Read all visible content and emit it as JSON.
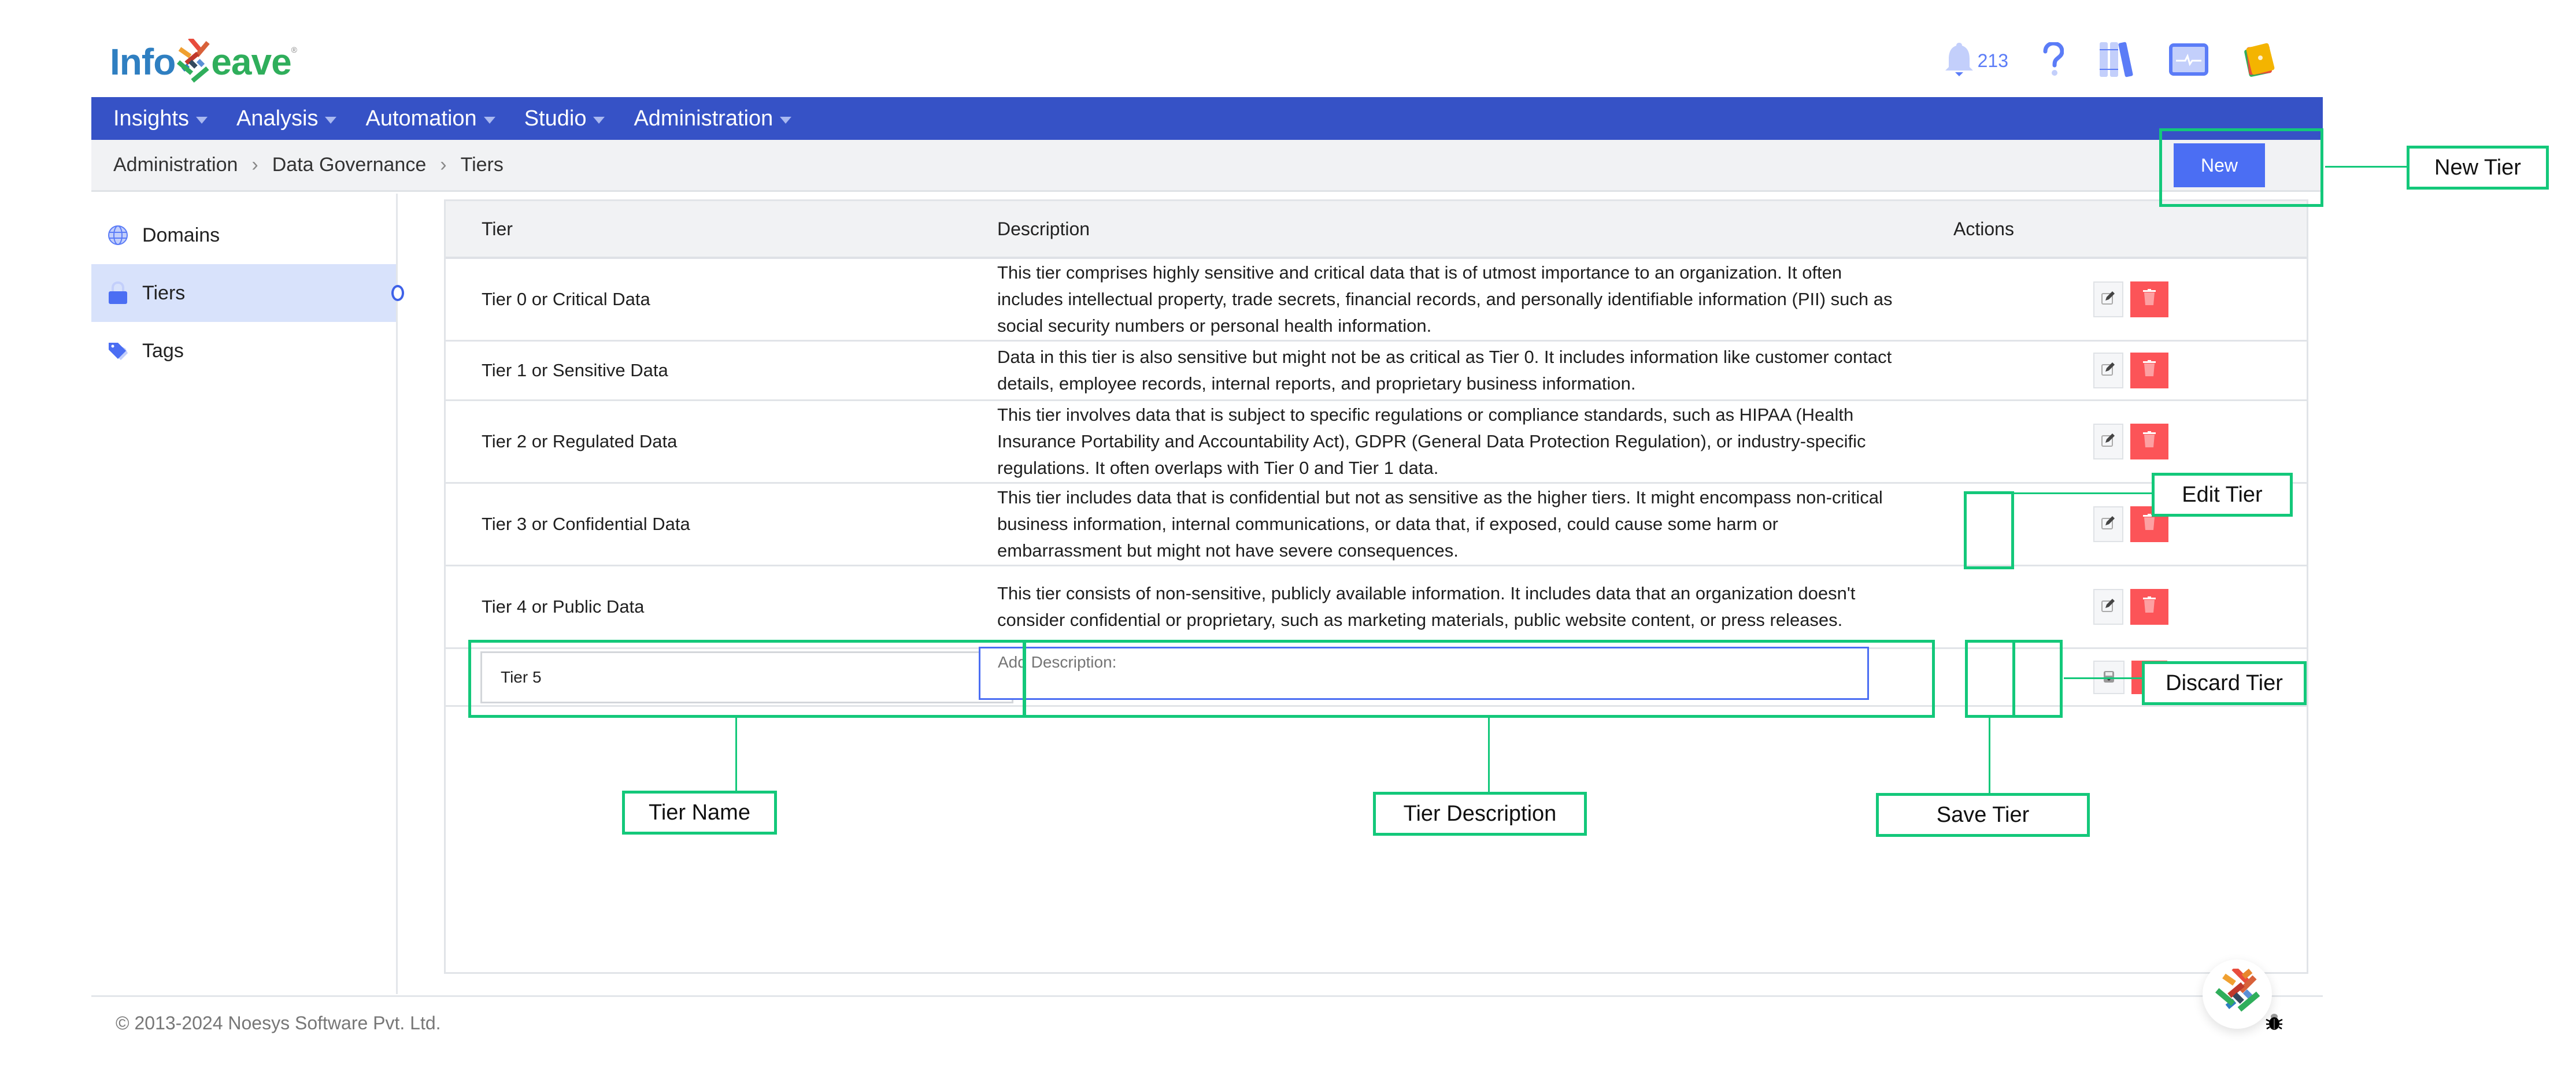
{
  "brand": {
    "name_part1": "Info",
    "name_part2": "eave",
    "registered": "®"
  },
  "header": {
    "notification_count": "213"
  },
  "nav": {
    "items": [
      {
        "label": "Insights"
      },
      {
        "label": "Analysis"
      },
      {
        "label": "Automation"
      },
      {
        "label": "Studio"
      },
      {
        "label": "Administration"
      }
    ]
  },
  "breadcrumb": {
    "items": [
      "Administration",
      "Data Governance",
      "Tiers"
    ],
    "separator": "›"
  },
  "toolbar": {
    "new_label": "New"
  },
  "sidebar": {
    "items": [
      {
        "label": "Domains",
        "icon": "globe-icon",
        "active": false
      },
      {
        "label": "Tiers",
        "icon": "lock-icon",
        "active": true
      },
      {
        "label": "Tags",
        "icon": "tag-icon",
        "active": false
      }
    ]
  },
  "table": {
    "columns": [
      "Tier",
      "Description",
      "Actions"
    ],
    "rows": [
      {
        "tier": "Tier 0 or Critical Data",
        "description": "This tier comprises highly sensitive and critical data that is of utmost importance to an organization. It often includes intellectual property, trade secrets, financial records, and personally identifiable information (PII) such as social security numbers or personal health information."
      },
      {
        "tier": "Tier 1 or Sensitive Data",
        "description": "Data in this tier is also sensitive but might not be as critical as Tier 0. It includes information like customer contact details, employee records, internal reports, and proprietary business information."
      },
      {
        "tier": "Tier 2 or Regulated Data",
        "description": "This tier involves data that is subject to specific regulations or compliance standards, such as HIPAA (Health Insurance Portability and Accountability Act), GDPR (General Data Protection Regulation), or industry-specific regulations. It often overlaps with Tier 0 and Tier 1 data."
      },
      {
        "tier": "Tier 3 or Confidential Data",
        "description": "This tier includes data that is confidential but not as sensitive as the higher tiers. It might encompass non-critical business information, internal communications, or data that, if exposed, could cause some harm or embarrassment but might not have severe consequences."
      },
      {
        "tier": "Tier 4 or Public Data",
        "description": "This tier consists of non-sensitive, publicly available information. It includes data that an organization doesn't consider confidential or proprietary, such as marketing materials, public website content, or press releases."
      }
    ],
    "new_row": {
      "tier_value": "Tier 5",
      "description_placeholder": "Add Description:"
    }
  },
  "annotations": {
    "new_tier": "New Tier",
    "edit_tier": "Edit Tier",
    "discard_tier": "Discard Tier",
    "tier_name": "Tier Name",
    "tier_description": "Tier Description",
    "save_tier": "Save Tier"
  },
  "footer": {
    "copyright": "© 2013-2024 Noesys Software Pvt. Ltd."
  },
  "colors": {
    "nav_bg": "#3652c6",
    "primary_button": "#4b6ef3",
    "delete_button": "#fc5458",
    "annotation": "#13c87a",
    "sidebar_active": "#d8e2fb"
  }
}
